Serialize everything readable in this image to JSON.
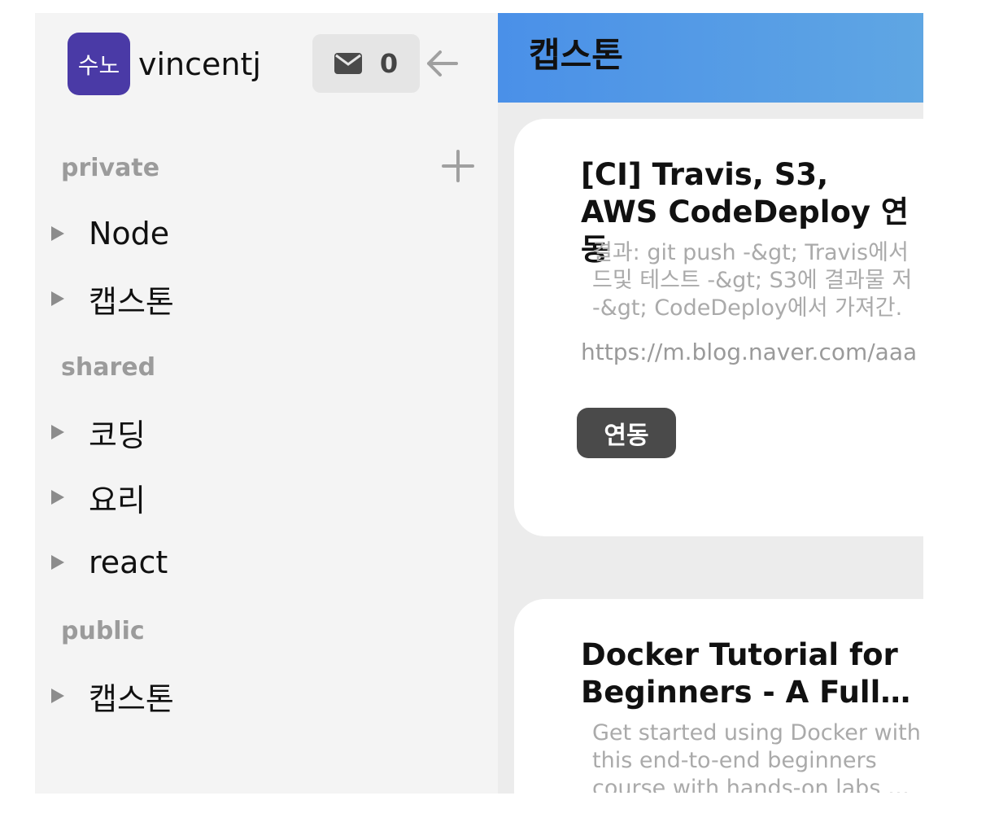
{
  "user": {
    "avatar_text": "수노",
    "avatar_color": "#4a3aa6",
    "name": "vincentj"
  },
  "mail": {
    "icon": "envelope-icon",
    "count": "0"
  },
  "back": {
    "icon": "arrow-left-icon"
  },
  "add": {
    "icon": "plus-icon"
  },
  "sections": {
    "private": {
      "label": "private",
      "items": [
        {
          "label": "Node"
        },
        {
          "label": "캡스톤"
        }
      ]
    },
    "shared": {
      "label": "shared",
      "items": [
        {
          "label": "코딩"
        },
        {
          "label": "요리"
        },
        {
          "label": "react"
        }
      ]
    },
    "public": {
      "label": "public",
      "items": [
        {
          "label": "캡스톤"
        }
      ]
    }
  },
  "header": {
    "title": "캡스톤",
    "gradient": [
      "#4a90e8",
      "#5fa6e3"
    ]
  },
  "cards": [
    {
      "title": "[CI] Travis, S3, AWS CodeDeploy 연동",
      "desc": "결과: git push -&gt; Travis에서\n드및 테스트 -&gt; S3에 결과물 저\n-&gt; CodeDeploy에서 가져간.",
      "url": "https://m.blog.naver.com/aaa",
      "tag": "연동"
    },
    {
      "title": "Docker Tutorial for Beginners - A Full…",
      "desc": "Get started using Docker with\nthis end-to-end beginners\ncourse with hands-on labs …"
    }
  ]
}
